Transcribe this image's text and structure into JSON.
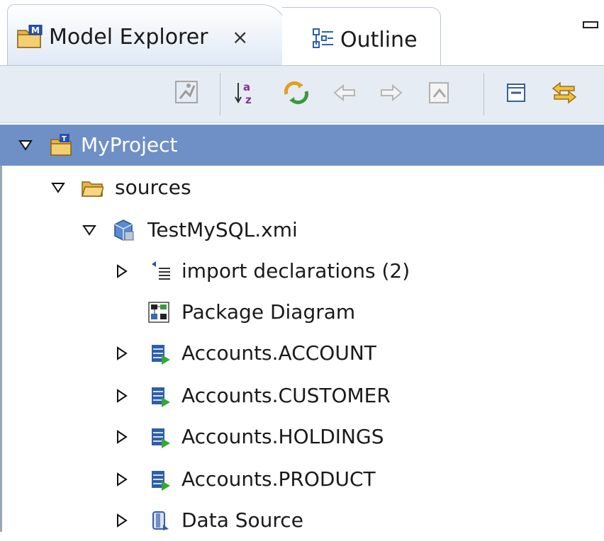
{
  "tabs": [
    {
      "label": "Model Explorer",
      "close_glyph": "⨯",
      "icon": "model-explorer-icon",
      "active": true
    },
    {
      "label": "Outline",
      "icon": "outline-icon",
      "active": false
    }
  ],
  "toolbar": {
    "buttons": [
      {
        "icon": "run-icon",
        "enabled": false
      },
      {
        "icon": "sort-alphabetical-icon",
        "enabled": true
      },
      {
        "icon": "link-with-editor-icon",
        "enabled": true
      },
      {
        "icon": "back-arrow-icon",
        "enabled": false
      },
      {
        "icon": "forward-arrow-icon",
        "enabled": false
      },
      {
        "icon": "go-up-icon",
        "enabled": false
      },
      {
        "icon": "collapse-all-icon",
        "enabled": true
      },
      {
        "icon": "sync-icon",
        "enabled": true
      }
    ]
  },
  "tree": [
    {
      "label": "MyProject",
      "expanded": true,
      "selected": true,
      "icon": "project-folder-icon"
    },
    {
      "label": "sources",
      "expanded": true,
      "icon": "folder-icon"
    },
    {
      "label": "TestMySQL.xmi",
      "expanded": true,
      "icon": "model-file-icon"
    },
    {
      "label": "import declarations (2)",
      "expanded": false,
      "icon": "import-icon"
    },
    {
      "label": "Package Diagram",
      "icon": "diagram-icon"
    },
    {
      "label": "Accounts.ACCOUNT",
      "expanded": false,
      "icon": "table-icon"
    },
    {
      "label": "Accounts.CUSTOMER",
      "expanded": false,
      "icon": "table-icon"
    },
    {
      "label": "Accounts.HOLDINGS",
      "expanded": false,
      "icon": "table-icon"
    },
    {
      "label": "Accounts.PRODUCT",
      "expanded": false,
      "icon": "table-icon"
    },
    {
      "label": "Data Source",
      "expanded": false,
      "icon": "data-source-icon"
    }
  ],
  "colors": {
    "selection": "#6e90c6",
    "toolbar_bg": "#e6ecf4",
    "tab_border": "#b9c6d6"
  }
}
